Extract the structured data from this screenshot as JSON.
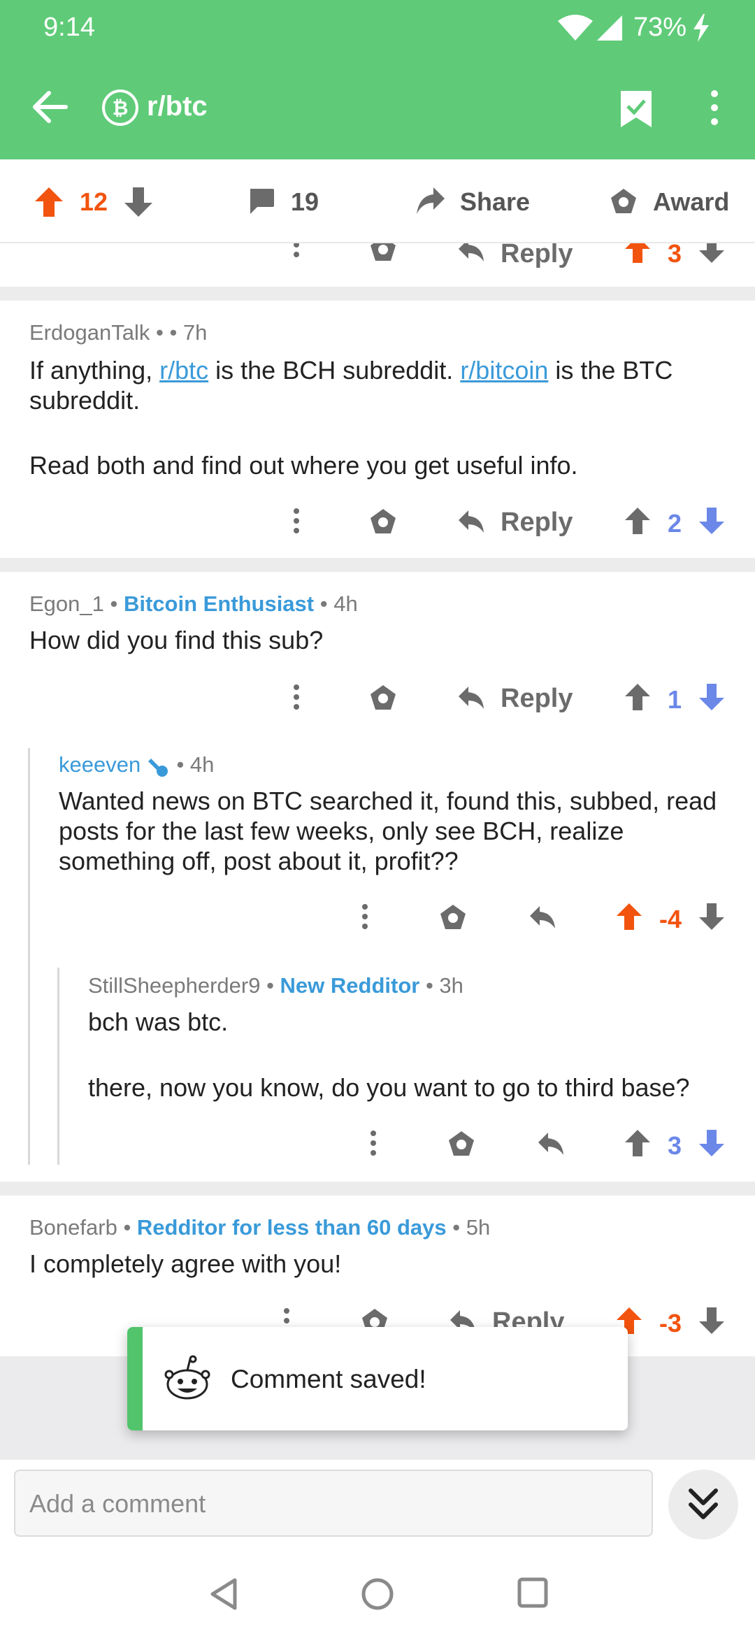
{
  "status": {
    "time": "9:14",
    "battery": "73%"
  },
  "header": {
    "subreddit": "r/btc",
    "subreddit_icon": "bitcoin-icon"
  },
  "post_actions": {
    "score": "12",
    "comments": "19",
    "share": "Share",
    "award": "Award"
  },
  "partial_comment": {
    "reply": "Reply",
    "score": "3"
  },
  "comments": [
    {
      "author": "ErdoganTalk",
      "sep1": "•",
      "sep2": "• 7h",
      "text_pre": "If anything, ",
      "link1": "r/btc",
      "text_mid": " is the BCH subreddit. ",
      "link2": "r/bitcoin",
      "text_post": " is the BTC subreddit.",
      "text2": "Read both and find out where you get useful info.",
      "reply": "Reply",
      "score": "2"
    },
    {
      "author": "Egon_1",
      "flair": "Bitcoin Enthusiast",
      "time": "• 4h",
      "text": "How did you find this sub?",
      "reply": "Reply",
      "score": "1"
    },
    {
      "author": "keeeven",
      "time": "• 4h",
      "text": "Wanted news on BTC searched it, found this, subbed, read posts for the last few weeks, only see BCH, realize something off, post about it, profit??",
      "score": "-4"
    },
    {
      "author": "StillSheepherder9",
      "flair": "New Redditor",
      "time": "• 3h",
      "text": "bch was btc.",
      "text2": "there, now you know, do you want to go to third base?",
      "score": "3"
    },
    {
      "author": "Bonefarb",
      "flair": "Redditor for less than 60 days",
      "time": "• 5h",
      "text": "I completely agree with you!",
      "reply": "Reply",
      "score": "-3"
    }
  ],
  "toast": {
    "message": "Comment saved!"
  },
  "composer": {
    "placeholder": "Add a comment"
  },
  "colors": {
    "header": "#5fcb78",
    "upvote": "#f2530e",
    "downvote": "#6b87e8",
    "link": "#3a9ad9"
  }
}
